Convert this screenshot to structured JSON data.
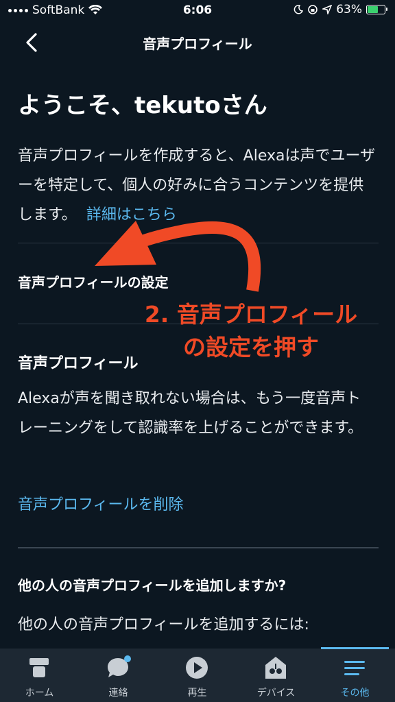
{
  "status_bar": {
    "carrier": "SoftBank",
    "time": "6:06",
    "battery": "63%"
  },
  "nav": {
    "title": "音声プロフィール"
  },
  "welcome": "ようこそ、tekutoさん",
  "intro": {
    "text": "音声プロフィールを作成すると、Alexaは声でユーザーを特定して、個人の好みに合うコンテンツを提供します。",
    "link": "詳細はこちら"
  },
  "settings_row": {
    "label": "音声プロフィールの設定"
  },
  "voice_profile": {
    "title": "音声プロフィール",
    "body": "Alexaが声を聞き取れない場合は、もう一度音声トレーニングをして認識率を上げることができます。",
    "delete_link": "音声プロフィールを削除"
  },
  "add_other": {
    "title": "他の人の音声プロフィールを追加しますか?",
    "body": "他の人の音声プロフィールを追加するには:"
  },
  "annotation": {
    "line1": "2. 音声プロフィール",
    "line2": "の設定を押す"
  },
  "tabs": [
    {
      "label": "ホーム",
      "icon": "home-icon"
    },
    {
      "label": "連絡",
      "icon": "chat-icon"
    },
    {
      "label": "再生",
      "icon": "play-icon"
    },
    {
      "label": "デバイス",
      "icon": "devices-icon"
    },
    {
      "label": "その他",
      "icon": "menu-icon",
      "active": true
    }
  ],
  "colors": {
    "background": "#0c1721",
    "link": "#5bb9ef",
    "annotation": "#f04a26",
    "tab_bar": "#1d2833"
  }
}
